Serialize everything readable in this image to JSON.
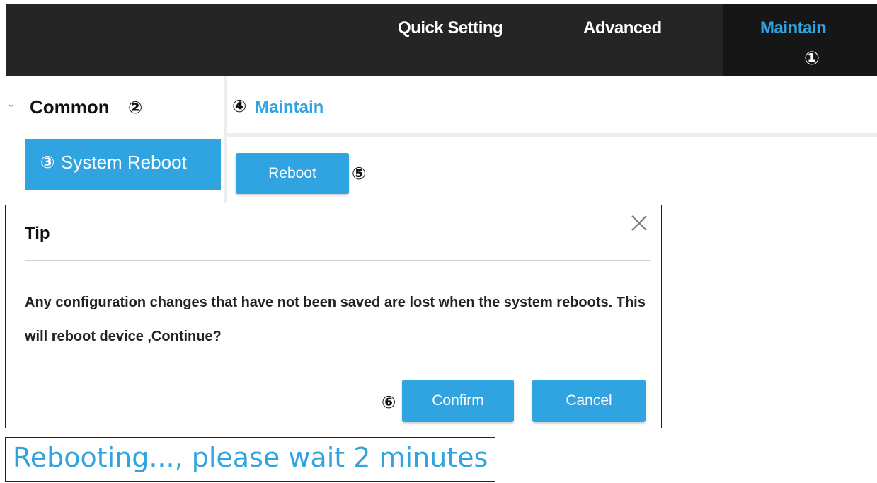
{
  "topnav": {
    "items": [
      {
        "label": "Quick Setting"
      },
      {
        "label": "Advanced"
      },
      {
        "label": "Maintain"
      }
    ],
    "active_marker": "①"
  },
  "sidebar": {
    "group_label": "Common",
    "group_marker": "②",
    "chevron": "⌄",
    "active_item_marker": "③",
    "active_item_label": "System Reboot"
  },
  "content": {
    "title_marker": "④",
    "title": "Maintain",
    "reboot_button": "Reboot",
    "reboot_marker": "⑤"
  },
  "dialog": {
    "title": "Tip",
    "message": "Any configuration changes that have not been saved are lost when the system reboots. This will reboot device ,Continue?",
    "confirm_marker": "⑥",
    "confirm_label": "Confirm",
    "cancel_label": "Cancel"
  },
  "status": {
    "text": "Rebooting..., please wait 2 minutes"
  },
  "colors": {
    "accent": "#2fa4e0",
    "topbar": "#252525",
    "topbar_active": "#161616"
  },
  "icons": {
    "close": "close-icon",
    "chevron": "chevron-down-icon"
  }
}
